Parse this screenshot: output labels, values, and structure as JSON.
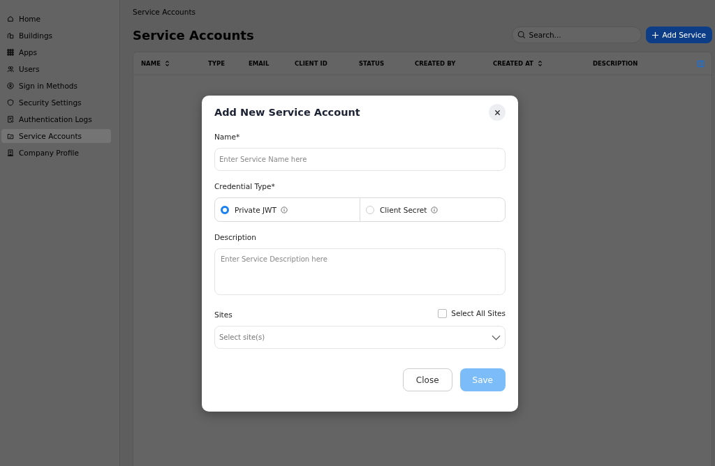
{
  "sidebar": {
    "items": [
      {
        "label": "Home",
        "selected": false
      },
      {
        "label": "Buildings",
        "selected": false
      },
      {
        "label": "Apps",
        "selected": false
      },
      {
        "label": "Users",
        "selected": false
      },
      {
        "label": "Sign in Methods",
        "selected": false
      },
      {
        "label": "Security Settings",
        "selected": false
      },
      {
        "label": "Authentication Logs",
        "selected": false
      },
      {
        "label": "Service Accounts",
        "selected": true
      },
      {
        "label": "Company Profile",
        "selected": false
      }
    ]
  },
  "breadcrumb": "Service Accounts",
  "page_title": "Service Accounts",
  "search": {
    "placeholder": "Search..."
  },
  "add_button": "Add Service",
  "table": {
    "columns": [
      {
        "label": "NAME",
        "sortable": true
      },
      {
        "label": "TYPE",
        "sortable": false
      },
      {
        "label": "EMAIL",
        "sortable": false
      },
      {
        "label": "CLIENT ID",
        "sortable": false
      },
      {
        "label": "STATUS",
        "sortable": false
      },
      {
        "label": "CREATED BY",
        "sortable": false
      },
      {
        "label": "CREATED AT",
        "sortable": true
      },
      {
        "label": "DESCRIPTION",
        "sortable": false
      }
    ]
  },
  "dialog": {
    "title": "Add New Service Account",
    "name": {
      "label": "Name*",
      "placeholder": "Enter Service Name here"
    },
    "credential": {
      "label": "Credential Type*",
      "options": [
        {
          "label": "Private JWT",
          "selected": true
        },
        {
          "label": "Client Secret",
          "selected": false
        }
      ]
    },
    "description": {
      "label": "Description",
      "placeholder": "Enter Service Description here"
    },
    "sites": {
      "label": "Sites",
      "select_all": {
        "label": "Select All Sites",
        "checked": false
      },
      "placeholder": "Select site(s)"
    },
    "buttons": {
      "close": "Close",
      "save": {
        "label": "Save",
        "disabled": true
      }
    }
  }
}
